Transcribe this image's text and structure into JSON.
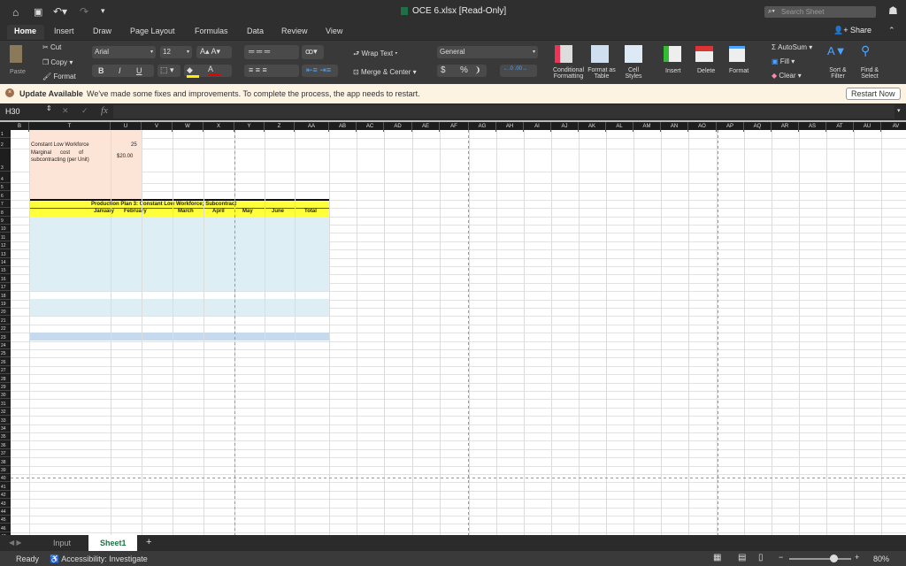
{
  "title": "OCE 6.xlsx  [Read-Only]",
  "search_placeholder": "Search Sheet",
  "share": "Share",
  "tabs": [
    "Home",
    "Insert",
    "Draw",
    "Page Layout",
    "Formulas",
    "Data",
    "Review",
    "View"
  ],
  "clipboard": {
    "paste": "Paste",
    "cut": "Cut",
    "copy": "Copy",
    "format": "Format"
  },
  "font": {
    "name": "Arial",
    "size": "12",
    "bold": "B",
    "italic": "I",
    "underline": "U"
  },
  "alignment": {
    "wrap": "Wrap Text",
    "merge": "Merge & Center"
  },
  "number": {
    "format": "General",
    "currency": "$",
    "percent": "%",
    "comma": "❩"
  },
  "styles": {
    "conditional": "Conditional Formatting",
    "table": "Format as Table",
    "cell": "Cell Styles"
  },
  "cells": {
    "insert": "Insert",
    "delete": "Delete",
    "format": "Format"
  },
  "editing": {
    "autosum": "AutoSum",
    "fill": "Fill",
    "clear": "Clear",
    "sort": "Sort & Filter",
    "find": "Find & Select"
  },
  "update": {
    "title": "Update Available",
    "message": "We've made some fixes and improvements. To complete the process, the app needs to restart.",
    "button": "Restart Now"
  },
  "formula_bar": {
    "name_box": "H30",
    "fx": "fx",
    "value": ""
  },
  "columns": [
    "B",
    "T",
    "U",
    "V",
    "W",
    "X",
    "Y",
    "Z",
    "AA",
    "AB",
    "AC",
    "AD",
    "AE",
    "AF",
    "AG",
    "AH",
    "AI",
    "AJ",
    "AK",
    "AL",
    "AM",
    "AN",
    "AO",
    "AP",
    "AQ",
    "AR",
    "AS",
    "AT",
    "AU",
    "AV"
  ],
  "sheet": {
    "label1": "Constant Low Workforce",
    "value1": "25",
    "label2a": "Marginal      cost      of",
    "label2b": "subcontracting (per Unit)",
    "value2": "$20.00",
    "table_title": "Production Plan 3:  Constant Low Workforce; Subcontract",
    "months": [
      "January",
      "February",
      "March",
      "April",
      "May",
      "June",
      "Total"
    ]
  },
  "colors": {
    "peach": "#fce4d6",
    "yellow": "#ffff3b",
    "lightblue": "#ddeef5",
    "midblue": "#c5d9ef"
  },
  "sheet_tabs": [
    "Input",
    "Sheet1"
  ],
  "status": {
    "ready": "Ready",
    "accessibility": "Accessibility: Investigate",
    "zoom": "80%",
    "zoom_level": 80
  }
}
